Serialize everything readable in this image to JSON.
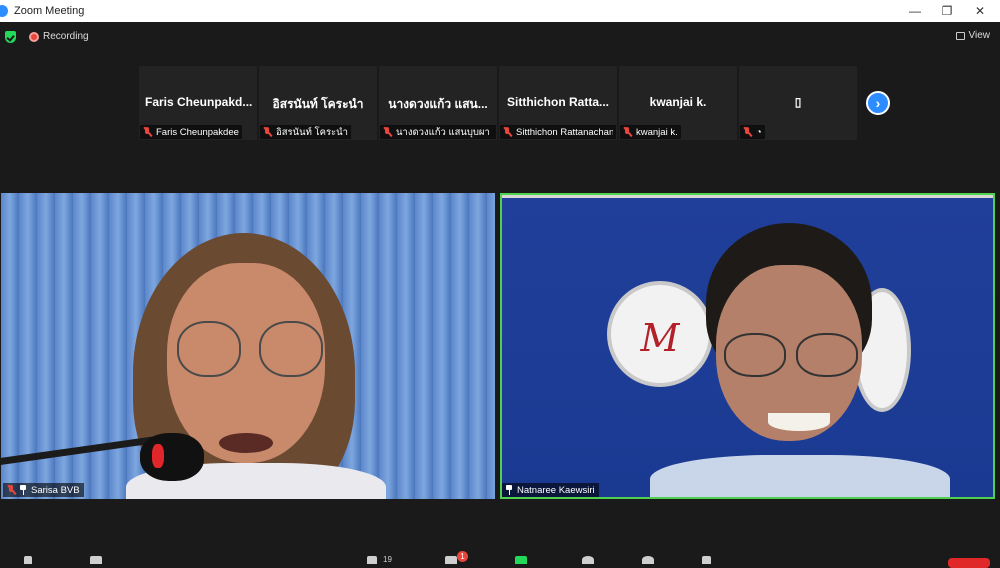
{
  "window": {
    "title": "Zoom Meeting",
    "minimize": "—",
    "restore": "❐",
    "close": "✕"
  },
  "topbar": {
    "recording_label": "Recording",
    "view_label": "View"
  },
  "gallery_strip": [
    {
      "display_name": "Faris  Cheunpakd...",
      "footer_name": "Faris Cheunpakdee"
    },
    {
      "display_name": "อิสรนันท์ โคระนำ",
      "footer_name": "อิสรนันท์ โคระนำ"
    },
    {
      "display_name": "นางดวงแก้ว แสน...",
      "footer_name": "นางดวงแก้ว แสนบุบผา ตำ..."
    },
    {
      "display_name": "Sitthichon  Ratta...",
      "footer_name": "Sitthichon Rattanachan"
    },
    {
      "display_name": "kwanjai k.",
      "footer_name": "kwanjai k."
    },
    {
      "display_name": "▯",
      "footer_name": "◔"
    }
  ],
  "next_page_glyph": "›",
  "videos": [
    {
      "participant": "Sarisa  BVB",
      "speaking": false,
      "muted": true
    },
    {
      "participant": "Natnaree Kaewsiri",
      "speaking": true,
      "muted": false
    }
  ],
  "toolbar": {
    "participants_count": "19",
    "chat_badge": "1"
  },
  "colors": {
    "accent": "#2d8cff",
    "mute_red": "#e8453c",
    "speaker_green": "#4fd04f",
    "background": "#1a1a1a"
  }
}
